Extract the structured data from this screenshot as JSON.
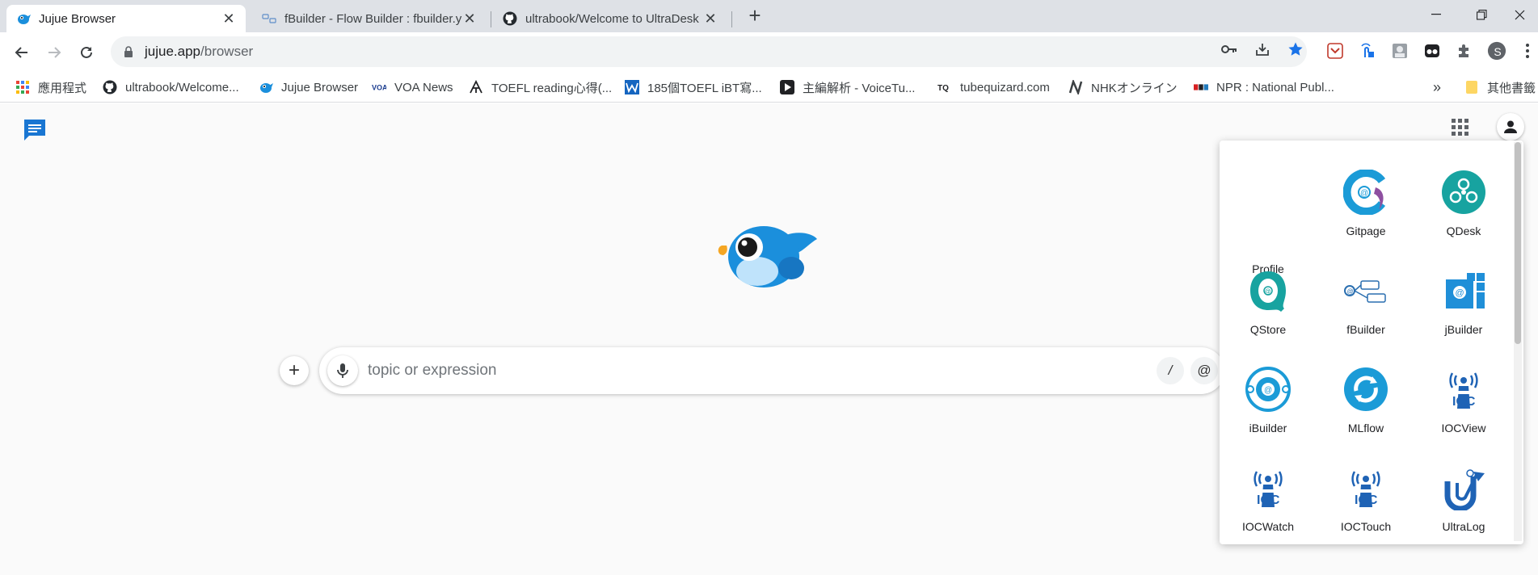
{
  "tabs": [
    {
      "title": "Jujue Browser",
      "active": true
    },
    {
      "title": "fBuilder - Flow Builder : fbuilder.y",
      "active": false
    },
    {
      "title": "ultrabook/Welcome to UltraDesk",
      "active": false
    }
  ],
  "window_controls": {
    "minimize": "—",
    "maximize": "❐",
    "close": "✕",
    "new_tab": "+"
  },
  "omnibox": {
    "host": "jujue.app",
    "path": "/browser"
  },
  "profile_avatar_letter": "S",
  "bookmarks": [
    {
      "label": "應用程式",
      "icon": "apps-grid-icon"
    },
    {
      "label": "ultrabook/Welcome...",
      "icon": "github-icon"
    },
    {
      "label": "Jujue Browser",
      "icon": "bird-icon"
    },
    {
      "label": "VOA News",
      "icon": "voa-icon"
    },
    {
      "label": "TOEFL reading心得(...",
      "icon": "toefl-icon"
    },
    {
      "label": "185個TOEFL iBT寫...",
      "icon": "w-icon"
    },
    {
      "label": "主編解析 - VoiceTu...",
      "icon": "voicetube-icon"
    },
    {
      "label": "tubequizard.com",
      "icon": "tq-icon"
    },
    {
      "label": "NHKオンライン",
      "icon": "nhk-icon"
    },
    {
      "label": "NPR : National Publ...",
      "icon": "npr-icon"
    }
  ],
  "bookmarks_overflow": "»",
  "other_bookmarks": "其他書籤",
  "search": {
    "placeholder": "topic or expression",
    "slash_label": "/",
    "at_label": "@",
    "plus_label": "+"
  },
  "apps_panel": {
    "profile_label": "Profile",
    "apps": [
      {
        "label": "Gitpage",
        "icon": "gitpage-icon",
        "color": "#1b9bd7"
      },
      {
        "label": "QDesk",
        "icon": "qdesk-icon",
        "color": "#17a3a0"
      },
      {
        "label": "QStore",
        "icon": "qstore-icon",
        "color": "#17a3a0"
      },
      {
        "label": "fBuilder",
        "icon": "fbuilder-icon",
        "color": "#2a6fb0"
      },
      {
        "label": "jBuilder",
        "icon": "jbuilder-icon",
        "color": "#1f8fd8"
      },
      {
        "label": "iBuilder",
        "icon": "ibuilder-icon",
        "color": "#1b9bd7"
      },
      {
        "label": "MLflow",
        "icon": "mlflow-icon",
        "color": "#1b9bd7"
      },
      {
        "label": "IOCView",
        "icon": "iocview-icon",
        "color": "#1f63b5"
      },
      {
        "label": "IOCWatch",
        "icon": "iocwatch-icon",
        "color": "#1f63b5"
      },
      {
        "label": "IOCTouch",
        "icon": "ioctouch-icon",
        "color": "#1f63b5"
      },
      {
        "label": "UltraLog",
        "icon": "ultralog-icon",
        "color": "#1f63b5"
      }
    ]
  },
  "colors": {
    "accent_blue": "#1a73e8",
    "chat_icon_blue": "#1976d2",
    "bird_blue": "#1b8fdc",
    "tabstrip_bg": "#dee1e6"
  }
}
